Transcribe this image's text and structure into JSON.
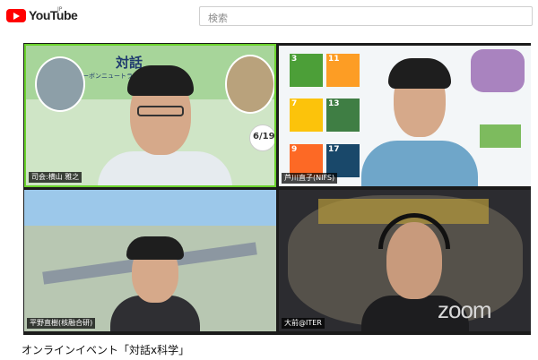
{
  "header": {
    "logo_word": "YouTube",
    "region": "JP",
    "search_placeholder": "検索"
  },
  "participants": [
    {
      "name": "司会:横山 雅之"
    },
    {
      "name": "芦川直子(NIFS)"
    },
    {
      "name": "平野直樹(核融合研)"
    },
    {
      "name": "大前@ITER"
    }
  ],
  "slide_title": "対話",
  "slide_subtitle": "カーボンニュートラル",
  "event_date": "6/19",
  "sdg_numbers": [
    "3",
    "11",
    "7",
    "13",
    "9",
    "17"
  ],
  "watermark": "zoom",
  "video_title": "オンラインイベント「対話x科学」",
  "colors": {
    "brand_red": "#ff0000",
    "speaker_border": "#6bd22c",
    "sdg3": "#4c9f38",
    "sdg11": "#fd9d24",
    "sdg7": "#fcc30b",
    "sdg13": "#3f7e44",
    "sdg9": "#fd6925",
    "sdg17": "#19486a"
  }
}
